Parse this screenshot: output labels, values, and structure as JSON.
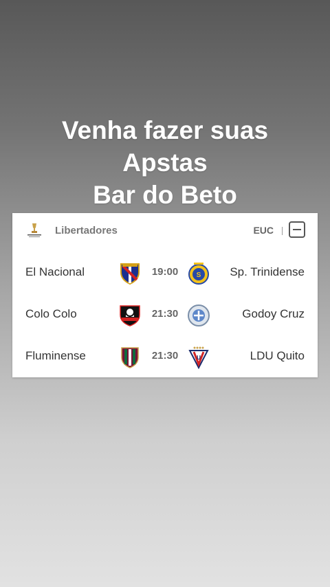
{
  "headline": {
    "line1": "Venha fazer suas",
    "line2": "Apstas",
    "line3": "Bar do Beto"
  },
  "card": {
    "league_name": "Libertadores",
    "league_logo_icon": "libertadores-trophy-icon",
    "region_label": "EUC",
    "collapse_icon": "minus-square-icon",
    "matches": [
      {
        "home": "El Nacional",
        "home_crest": "el-nacional-crest-icon",
        "time": "19:00",
        "away": "Sp. Trinidense",
        "away_crest": "sportivo-trinidense-crest-icon"
      },
      {
        "home": "Colo Colo",
        "home_crest": "colo-colo-crest-icon",
        "time": "21:30",
        "away": "Godoy Cruz",
        "away_crest": "godoy-cruz-crest-icon"
      },
      {
        "home": "Fluminense",
        "home_crest": "fluminense-crest-icon",
        "time": "21:30",
        "away": "LDU Quito",
        "away_crest": "ldu-quito-crest-icon"
      }
    ]
  },
  "colors": {
    "headline_text": "#ffffff",
    "card_background": "#ffffff",
    "time_text": "#666666"
  }
}
